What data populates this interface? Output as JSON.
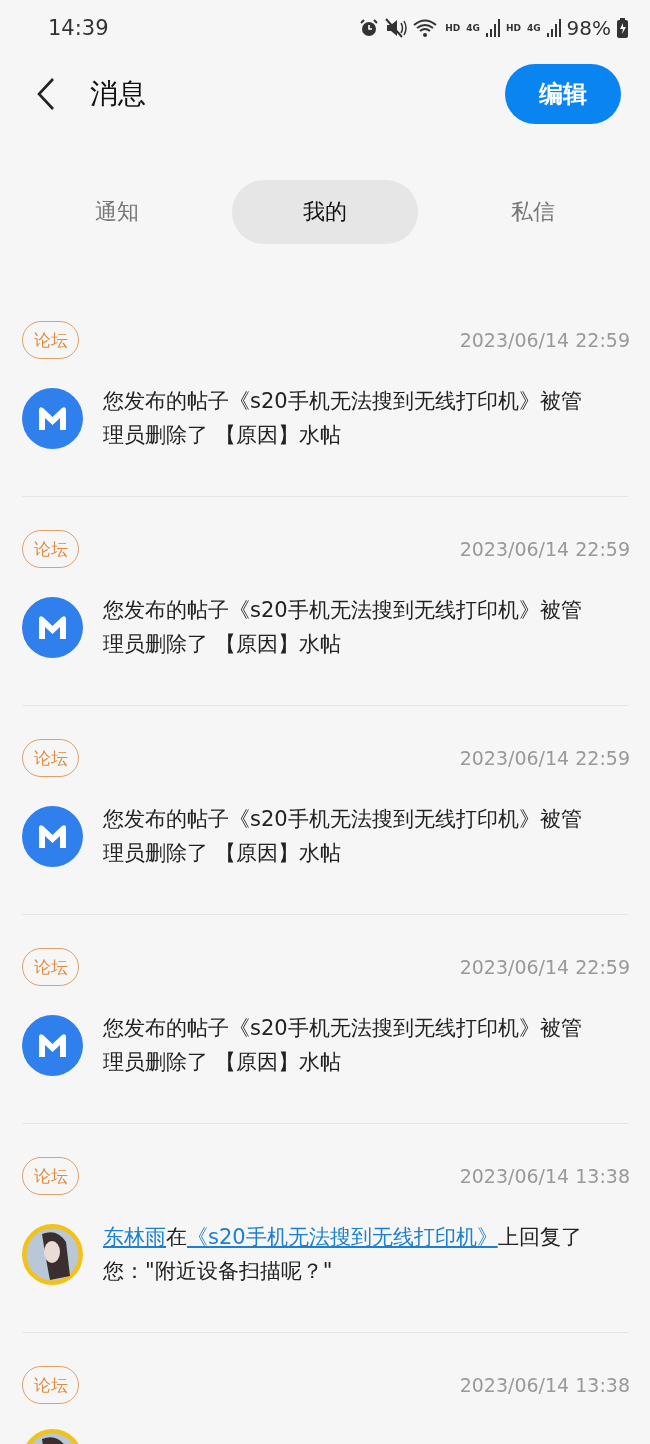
{
  "status_bar": {
    "time": "14:39",
    "networks": [
      {
        "hd": "HD",
        "gen": "4G"
      },
      {
        "hd": "HD",
        "gen": "4G"
      }
    ],
    "battery": "98%"
  },
  "header": {
    "title": "消息",
    "edit_button": "编辑"
  },
  "tabs": [
    {
      "label": "通知",
      "selected": false
    },
    {
      "label": "我的",
      "selected": true
    },
    {
      "label": "私信",
      "selected": false
    }
  ],
  "messages": [
    {
      "tag": "论坛",
      "time": "2023/06/14 22:59",
      "avatar": {
        "kind": "app"
      },
      "segments": [
        {
          "kind": "text",
          "text": "您发布的帖子《s20手机无法搜到无线打印机》被管理员删除了 【原因】水帖"
        }
      ]
    },
    {
      "tag": "论坛",
      "time": "2023/06/14 22:59",
      "avatar": {
        "kind": "app"
      },
      "segments": [
        {
          "kind": "text",
          "text": "您发布的帖子《s20手机无法搜到无线打印机》被管理员删除了 【原因】水帖"
        }
      ]
    },
    {
      "tag": "论坛",
      "time": "2023/06/14 22:59",
      "avatar": {
        "kind": "app"
      },
      "segments": [
        {
          "kind": "text",
          "text": "您发布的帖子《s20手机无法搜到无线打印机》被管理员删除了 【原因】水帖"
        }
      ]
    },
    {
      "tag": "论坛",
      "time": "2023/06/14 22:59",
      "avatar": {
        "kind": "app"
      },
      "segments": [
        {
          "kind": "text",
          "text": "您发布的帖子《s20手机无法搜到无线打印机》被管理员删除了 【原因】水帖"
        }
      ]
    },
    {
      "tag": "论坛",
      "time": "2023/06/14 13:38",
      "avatar": {
        "kind": "user"
      },
      "segments": [
        {
          "kind": "link",
          "text": "东林雨"
        },
        {
          "kind": "text",
          "text": "在"
        },
        {
          "kind": "link",
          "text": "《s20手机无法搜到无线打印机》"
        },
        {
          "kind": "text",
          "text": "上回复了您：\"附近设备扫描呢？\""
        }
      ]
    },
    {
      "tag": "论坛",
      "time": "2023/06/14 13:38",
      "avatar": {
        "kind": "user"
      }
    }
  ]
}
